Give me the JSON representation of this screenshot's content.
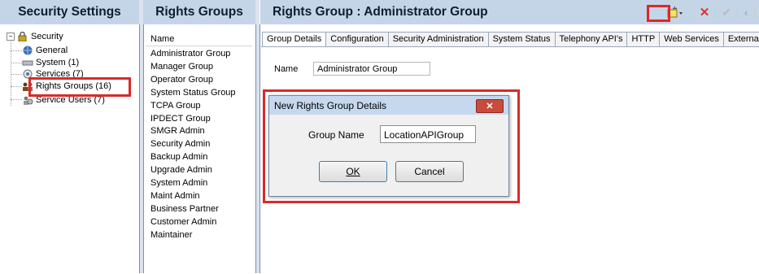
{
  "security_settings": {
    "title": "Security Settings",
    "tree": [
      {
        "label": "Security",
        "icon": "lock-folder-icon"
      },
      {
        "label": "General",
        "icon": "globe-icon"
      },
      {
        "label": "System (1)",
        "icon": "server-icon"
      },
      {
        "label": "Services (7)",
        "icon": "services-icon"
      },
      {
        "label": "Rights Groups (16)",
        "icon": "group-icon"
      },
      {
        "label": "Service Users (7)",
        "icon": "users-icon"
      }
    ]
  },
  "rights_groups": {
    "title": "Rights Groups",
    "column_header": "Name",
    "items": [
      "Administrator Group",
      "Manager Group",
      "Operator Group",
      "System Status Group",
      "TCPA Group",
      "IPDECT Group",
      "SMGR Admin",
      "Security Admin",
      "Backup Admin",
      "Upgrade Admin",
      "System Admin",
      "Maint Admin",
      "Business Partner",
      "Customer Admin",
      "Maintainer"
    ]
  },
  "main": {
    "title": "Rights Group :   Administrator Group",
    "tabs": [
      "Group Details",
      "Configuration",
      "Security Administration",
      "System Status",
      "Telephony API's",
      "HTTP",
      "Web Services",
      "External"
    ],
    "name_label": "Name",
    "name_value": "Administrator Group"
  },
  "toolbar": {
    "new_icon": "new-icon",
    "delete_icon": "delete-icon",
    "check_icon": "check-icon",
    "back_icon": "back-icon"
  },
  "dialog": {
    "title": "New Rights Group Details",
    "group_name_label": "Group Name",
    "group_name_value": "LocationAPIGroup",
    "ok_label": "OK",
    "cancel_label": "Cancel"
  },
  "colors": {
    "header_bg": "#c5d5e8",
    "highlight": "#d92a2a",
    "dialog_title_bg": "#c6d8ee"
  }
}
